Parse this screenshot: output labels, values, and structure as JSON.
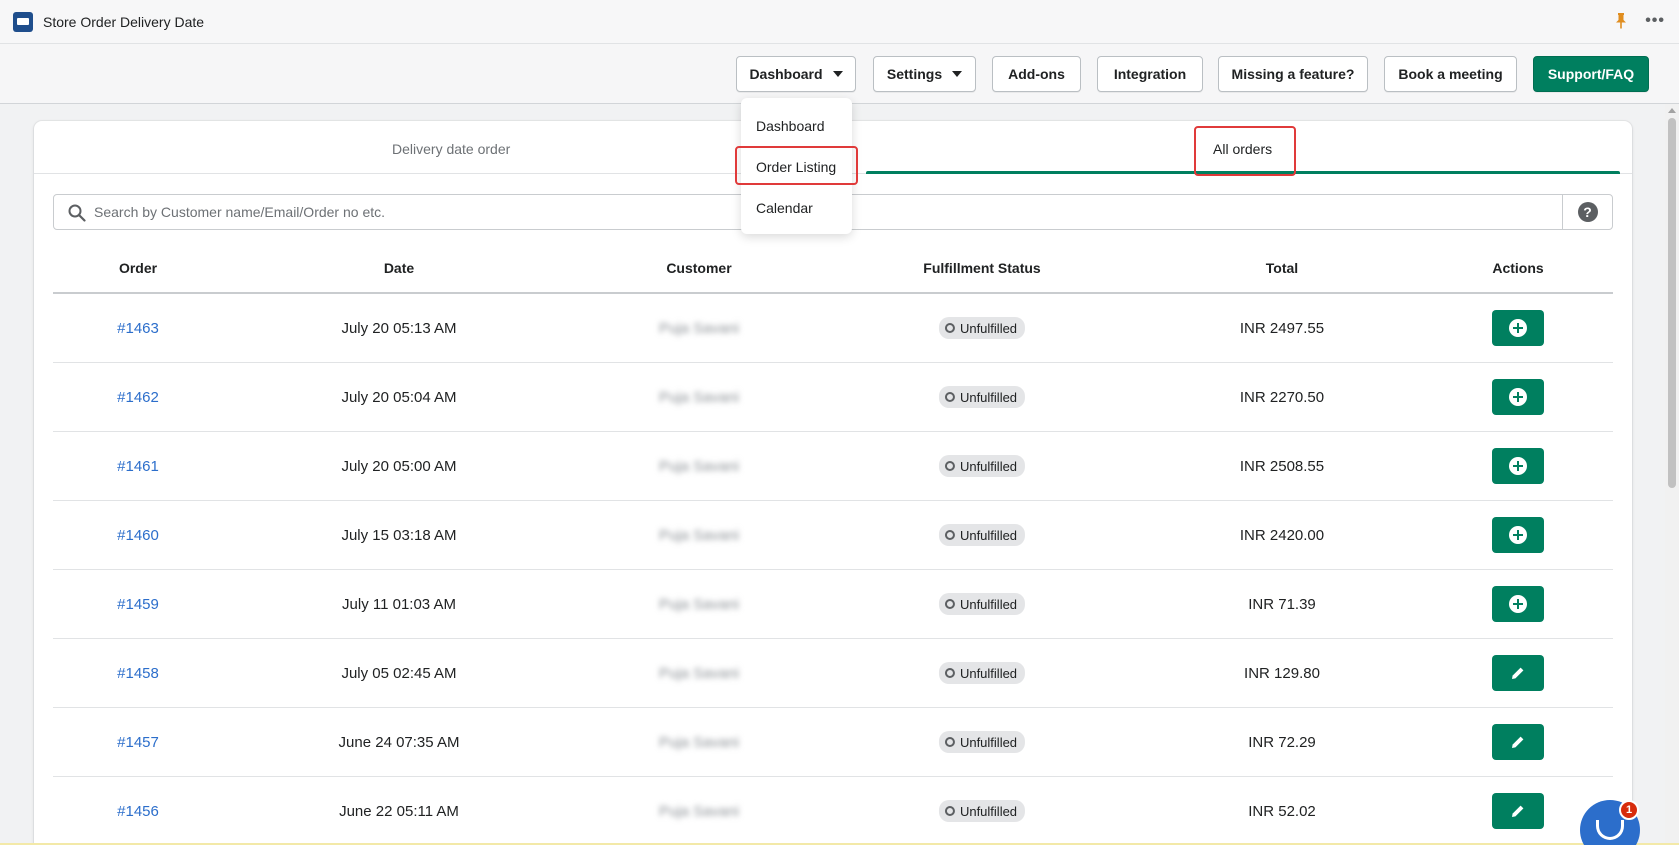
{
  "app": {
    "title": "Store Order Delivery Date"
  },
  "nav": {
    "dashboard": "Dashboard",
    "settings": "Settings",
    "addons": "Add-ons",
    "integration": "Integration",
    "missing_feature": "Missing a feature?",
    "book_meeting": "Book a meeting",
    "support": "Support/FAQ"
  },
  "dropdown": {
    "items": [
      {
        "label": "Dashboard"
      },
      {
        "label": "Order Listing"
      },
      {
        "label": "Calendar"
      }
    ]
  },
  "tabs": [
    {
      "label": "Delivery date order",
      "active": false
    },
    {
      "label": "All orders",
      "active": true
    }
  ],
  "search": {
    "placeholder": "Search by Customer name/Email/Order no etc."
  },
  "table": {
    "headers": [
      "Order",
      "Date",
      "Customer",
      "Fulfillment Status",
      "Total",
      "Actions"
    ],
    "rows": [
      {
        "order": "#1463",
        "date": "July 20 05:13 AM",
        "customer": "Puja Savani",
        "status": "Unfulfilled",
        "total": "INR 2497.55",
        "action": "plus-circle-icon"
      },
      {
        "order": "#1462",
        "date": "July 20 05:04 AM",
        "customer": "Puja Savani",
        "status": "Unfulfilled",
        "total": "INR 2270.50",
        "action": "plus-circle-icon"
      },
      {
        "order": "#1461",
        "date": "July 20 05:00 AM",
        "customer": "Puja Savani",
        "status": "Unfulfilled",
        "total": "INR 2508.55",
        "action": "plus-circle-icon"
      },
      {
        "order": "#1460",
        "date": "July 15 03:18 AM",
        "customer": "Puja Savani",
        "status": "Unfulfilled",
        "total": "INR 2420.00",
        "action": "plus-circle-icon"
      },
      {
        "order": "#1459",
        "date": "July 11 01:03 AM",
        "customer": "Puja Savani",
        "status": "Unfulfilled",
        "total": "INR 71.39",
        "action": "plus-circle-icon"
      },
      {
        "order": "#1458",
        "date": "July 05 02:45 AM",
        "customer": "Puja Savani",
        "status": "Unfulfilled",
        "total": "INR 129.80",
        "action": "pencil-icon"
      },
      {
        "order": "#1457",
        "date": "June 24 07:35 AM",
        "customer": "Puja Savani",
        "status": "Unfulfilled",
        "total": "INR 72.29",
        "action": "pencil-icon"
      },
      {
        "order": "#1456",
        "date": "June 22 05:11 AM",
        "customer": "Puja Savani",
        "status": "Unfulfilled",
        "total": "INR 52.02",
        "action": "pencil-icon"
      }
    ]
  },
  "chat": {
    "badge_count": "1"
  },
  "colors": {
    "primary": "#007f5f",
    "link": "#2c6ecb",
    "highlight": "#e03a3a"
  }
}
